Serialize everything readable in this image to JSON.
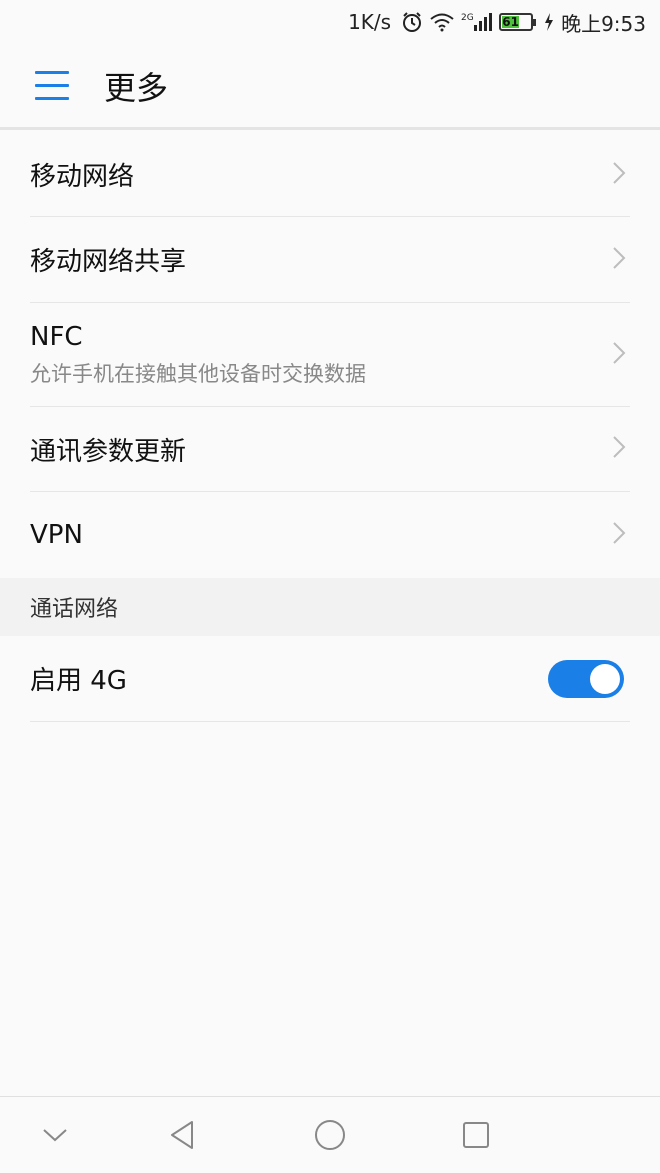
{
  "status_bar": {
    "net_speed": "1K/s",
    "battery_level": "61",
    "time": "晚上9:53",
    "network_type": "2G",
    "icons": [
      "alarm-icon",
      "wifi-icon",
      "signal-icon",
      "battery-icon",
      "charging-icon"
    ]
  },
  "app_bar": {
    "menu_icon": "hamburger-menu-icon",
    "title": "更多"
  },
  "list": {
    "items": [
      {
        "label": "移动网络"
      },
      {
        "label": "移动网络共享"
      },
      {
        "label": "NFC",
        "sub": "允许手机在接触其他设备时交换数据"
      },
      {
        "label": "通讯参数更新"
      },
      {
        "label": "VPN"
      }
    ],
    "section_header": "通话网络",
    "toggle_item": {
      "label": "启用 4G",
      "enabled": true
    }
  },
  "colors": {
    "accent": "#1a7fe6",
    "background": "#fafafa",
    "section_bg": "#f2f2f2",
    "divider": "#e6e6e6"
  },
  "nav_bar": {
    "icons": [
      "chevron-down-icon",
      "back-icon",
      "home-icon",
      "recents-icon"
    ]
  }
}
